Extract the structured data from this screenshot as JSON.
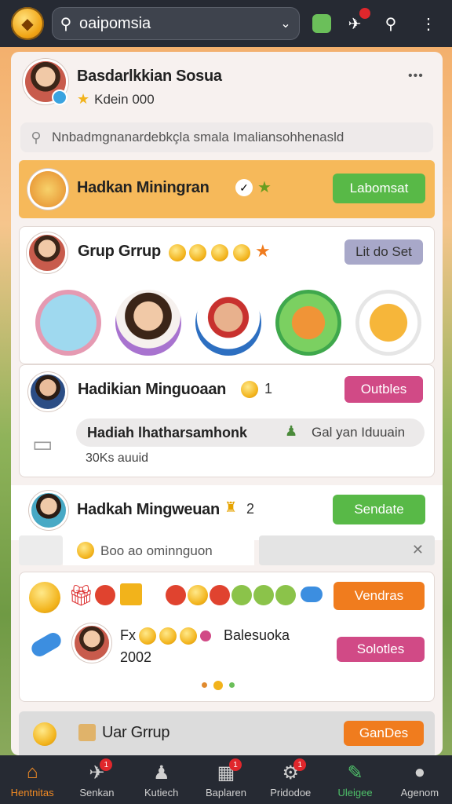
{
  "topbar": {
    "search_value": "oaipomsia",
    "icons": [
      "map-icon",
      "rocket-icon",
      "search-sparkle-icon",
      "more-vert-icon"
    ]
  },
  "profile": {
    "name": "Basdarlkkian Sosua",
    "subtitle": "Kdein 000",
    "more": "•••"
  },
  "search": {
    "placeholder": "Nnbadmgnanardebkçla smala Imaliansohhenasld"
  },
  "promo": {
    "title": "Hadkan Miningran",
    "button": "Labomsat"
  },
  "group": {
    "title": "Grup Grrup",
    "button": "Lit do Set"
  },
  "weekly1": {
    "title": "Hadikian Minguoaan",
    "count": "1",
    "button": "Outbles",
    "reward_title": "Hadiah lhatharsamhonk",
    "reward_side": "Gal yan Iduuain",
    "reward_sub": "30Ks auuid"
  },
  "weekly2": {
    "title": "Hadkah Mingweuan",
    "count": "2",
    "button": "Sendate",
    "input_placeholder": "Boo ao ominnguon"
  },
  "rewards": {
    "btn1": "Vendras",
    "btn2": "Solotles",
    "fx": "Fx",
    "name": "Balesuoka",
    "year": "2002"
  },
  "bottom_card": {
    "title": "Uar Grrup",
    "button": "GanDes"
  },
  "nav": [
    {
      "label": "Hentnitas",
      "icon": "home-icon",
      "badge": ""
    },
    {
      "label": "Senkan",
      "icon": "megaphone-icon",
      "badge": "1"
    },
    {
      "label": "Kutiech",
      "icon": "people-icon",
      "badge": ""
    },
    {
      "label": "Baplaren",
      "icon": "calendar-icon",
      "badge": "1"
    },
    {
      "label": "Pridodoe",
      "icon": "settings-icon",
      "badge": "1"
    },
    {
      "label": "Uleigee",
      "icon": "edit-icon",
      "badge": ""
    },
    {
      "label": "Agenom",
      "icon": "person-icon",
      "badge": ""
    }
  ],
  "colors": {
    "accent_orange": "#f07c1e",
    "green": "#58b947",
    "pink": "#d14a86",
    "dark": "#262a33"
  }
}
